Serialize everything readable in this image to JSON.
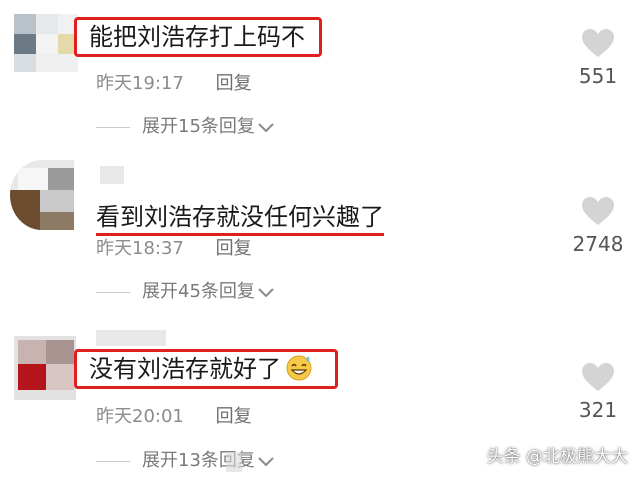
{
  "comments": [
    {
      "text": "能把刘浩存打上码不",
      "time": "昨天19:17",
      "reply_label": "回复",
      "expand_label": "展开15条回复",
      "likes": "551"
    },
    {
      "text": "看到刘浩存就没任何兴趣了",
      "time": "昨天18:37",
      "reply_label": "回复",
      "expand_label": "展开45条回复",
      "likes": "2748"
    },
    {
      "text": "没有刘浩存就好了",
      "time": "昨天20:01",
      "reply_label": "回复",
      "expand_label": "展开13条回复",
      "likes": "321"
    }
  ],
  "watermark": "头条 @北极熊大大",
  "colors": {
    "highlight": "#e0201e",
    "heart": "#d4d4d4"
  },
  "icons": {
    "like": "heart-icon",
    "expand": "chevron-down-icon",
    "emoji": "grinning-sweat-emoji"
  }
}
